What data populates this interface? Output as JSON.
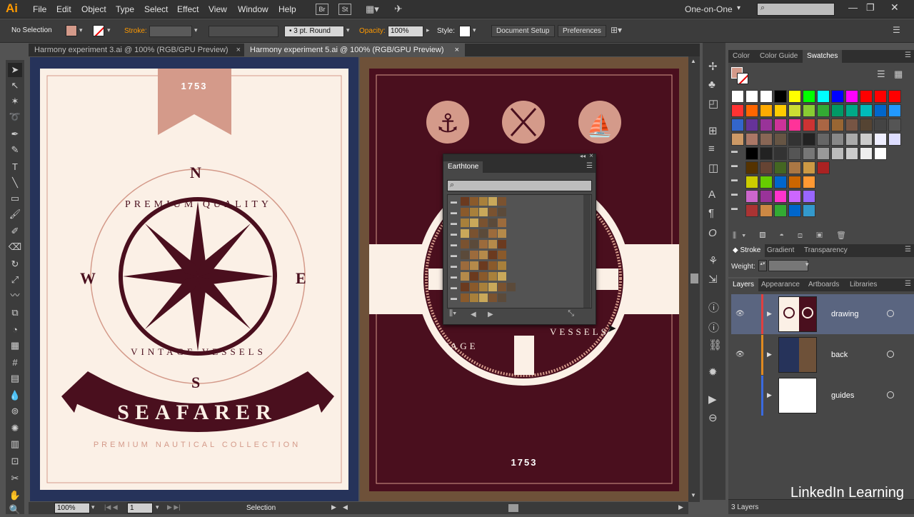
{
  "app": {
    "logo": "Ai",
    "workspace": "One-on-One"
  },
  "menu": [
    "File",
    "Edit",
    "Object",
    "Type",
    "Select",
    "Effect",
    "View",
    "Window",
    "Help"
  ],
  "menu_icons": [
    "Br",
    "St"
  ],
  "control": {
    "selection": "No Selection",
    "stroke_label": "Stroke:",
    "brush": "3 pt. Round",
    "opacity_label": "Opacity:",
    "opacity": "100%",
    "style_label": "Style:",
    "doc_setup": "Document Setup",
    "preferences": "Preferences"
  },
  "tabs": [
    {
      "label": "Harmony experiment 3.ai @ 100% (RGB/GPU Preview)"
    },
    {
      "label": "Harmony experiment 5.ai @ 100% (RGB/GPU Preview)"
    }
  ],
  "artboard1": {
    "year": "1753",
    "north": "N",
    "south": "S",
    "east": "E",
    "west": "W",
    "arc_top": "PREMIUM QUALITY",
    "arc_bottom": "VINTAGE VESSELS",
    "banner": "SEAFARER",
    "subtitle": "PREMIUM NAUTICAL COLLECTION"
  },
  "artboard2": {
    "year": "1753",
    "wheel_left": "TAGE",
    "wheel_right": "VESSELS"
  },
  "floating_panel": {
    "title": "Earthtone"
  },
  "right_panel": {
    "top_tabs": [
      "Color",
      "Color Guide",
      "Swatches"
    ],
    "mid_tabs": [
      "Stroke",
      "Gradient",
      "Transparency"
    ],
    "weight_label": "Weight:",
    "layer_tabs": [
      "Layers",
      "Appearance",
      "Artboards",
      "Libraries"
    ],
    "layers": [
      {
        "name": "drawing"
      },
      {
        "name": "back"
      },
      {
        "name": "guides"
      }
    ],
    "footer": "3 Layers"
  },
  "status": {
    "zoom": "100%",
    "page": "1",
    "tool": "Selection"
  },
  "watermark": "LinkedIn Learning",
  "colors": {
    "cream": "#fbf0e6",
    "maroon": "#4a0f1e",
    "salmon": "#d49a8a",
    "navy": "#26335a",
    "brown": "#6e5139"
  }
}
